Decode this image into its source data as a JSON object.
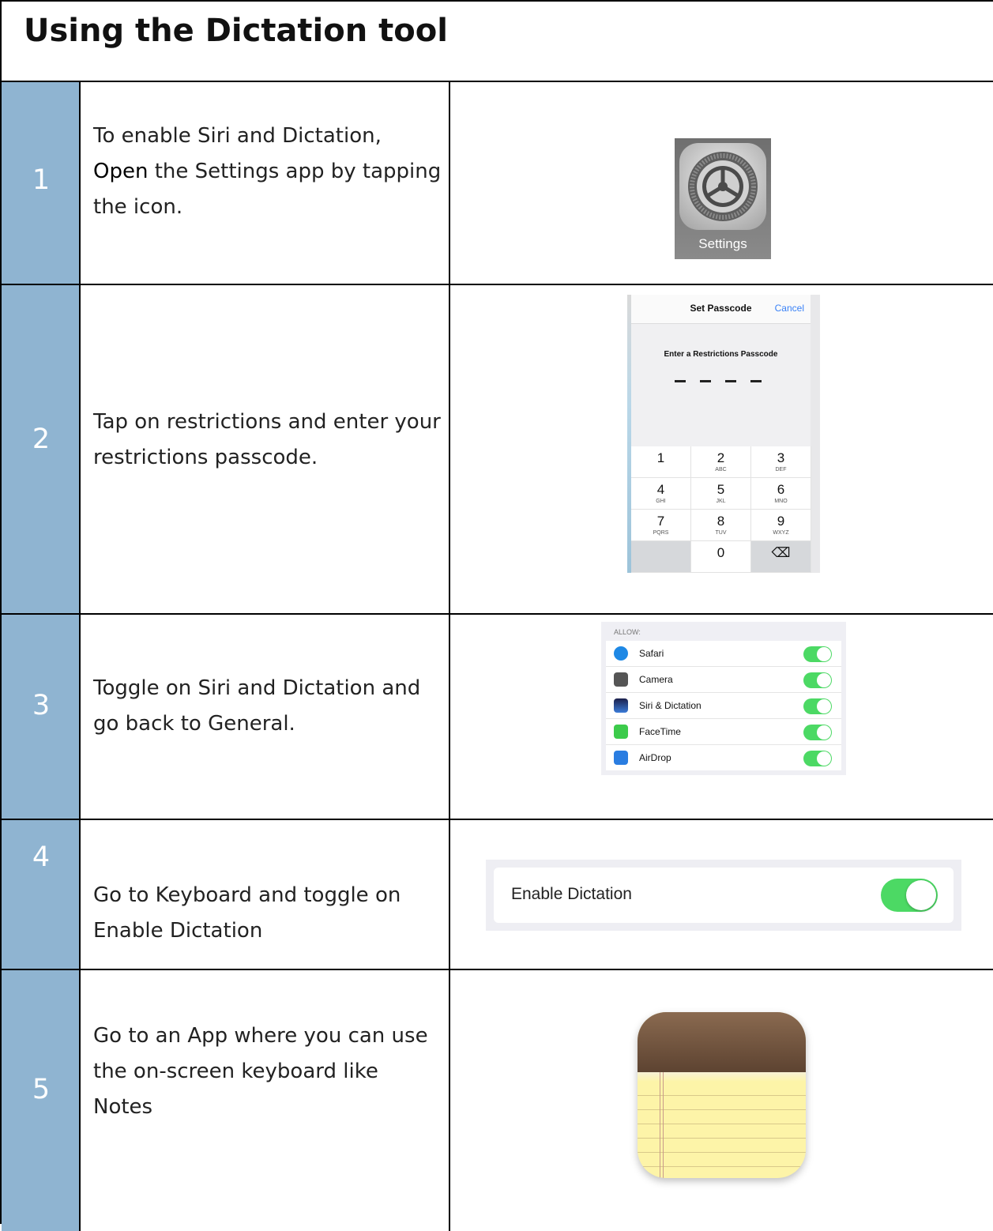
{
  "title": "Using the Dictation tool",
  "steps": [
    {
      "number": "1",
      "text_before": "To enable Siri and Dictation, ",
      "highlight": "Open",
      "text_after": " the Settings app by tapping the icon."
    },
    {
      "number": "2",
      "text": "Tap on restrictions and enter your restrictions passcode."
    },
    {
      "number": "3",
      "text": "Toggle on Siri and Dictation and go back to General."
    },
    {
      "number": "4",
      "text": "Go to Keyboard and toggle on Enable Dictation"
    },
    {
      "number": "5",
      "text": "Go to an App where you can use the on-screen keyboard like Notes"
    }
  ],
  "settings_icon": {
    "label": "Settings",
    "icon": "gear-icon"
  },
  "passcode_screen": {
    "title": "Set Passcode",
    "cancel": "Cancel",
    "prompt": "Enter a Restrictions Passcode",
    "keys": [
      {
        "digit": "1",
        "letters": ""
      },
      {
        "digit": "2",
        "letters": "ABC"
      },
      {
        "digit": "3",
        "letters": "DEF"
      },
      {
        "digit": "4",
        "letters": "GHI"
      },
      {
        "digit": "5",
        "letters": "JKL"
      },
      {
        "digit": "6",
        "letters": "MNO"
      },
      {
        "digit": "7",
        "letters": "PQRS"
      },
      {
        "digit": "8",
        "letters": "TUV"
      },
      {
        "digit": "9",
        "letters": "WXYZ"
      },
      {
        "digit": "",
        "letters": ""
      },
      {
        "digit": "0",
        "letters": ""
      },
      {
        "digit": "⌫",
        "letters": ""
      }
    ]
  },
  "allow_list": {
    "header": "ALLOW:",
    "items": [
      {
        "label": "Safari",
        "icon": "safari-icon",
        "color": "#1e88e5",
        "on": true
      },
      {
        "label": "Camera",
        "icon": "camera-icon",
        "color": "#555555",
        "on": true
      },
      {
        "label": "Siri & Dictation",
        "icon": "siri-icon",
        "color": "#2d3e8c",
        "on": true
      },
      {
        "label": "FaceTime",
        "icon": "facetime-icon",
        "color": "#3ccb4b",
        "on": true
      },
      {
        "label": "AirDrop",
        "icon": "airdrop-icon",
        "color": "#2a7de1",
        "on": true
      }
    ]
  },
  "dictation_setting": {
    "label": "Enable Dictation",
    "on": true
  },
  "notes_icon": {
    "icon": "notes-app-icon"
  },
  "colors": {
    "number_column": "#8fb4d1",
    "toggle_on": "#4cd964"
  }
}
